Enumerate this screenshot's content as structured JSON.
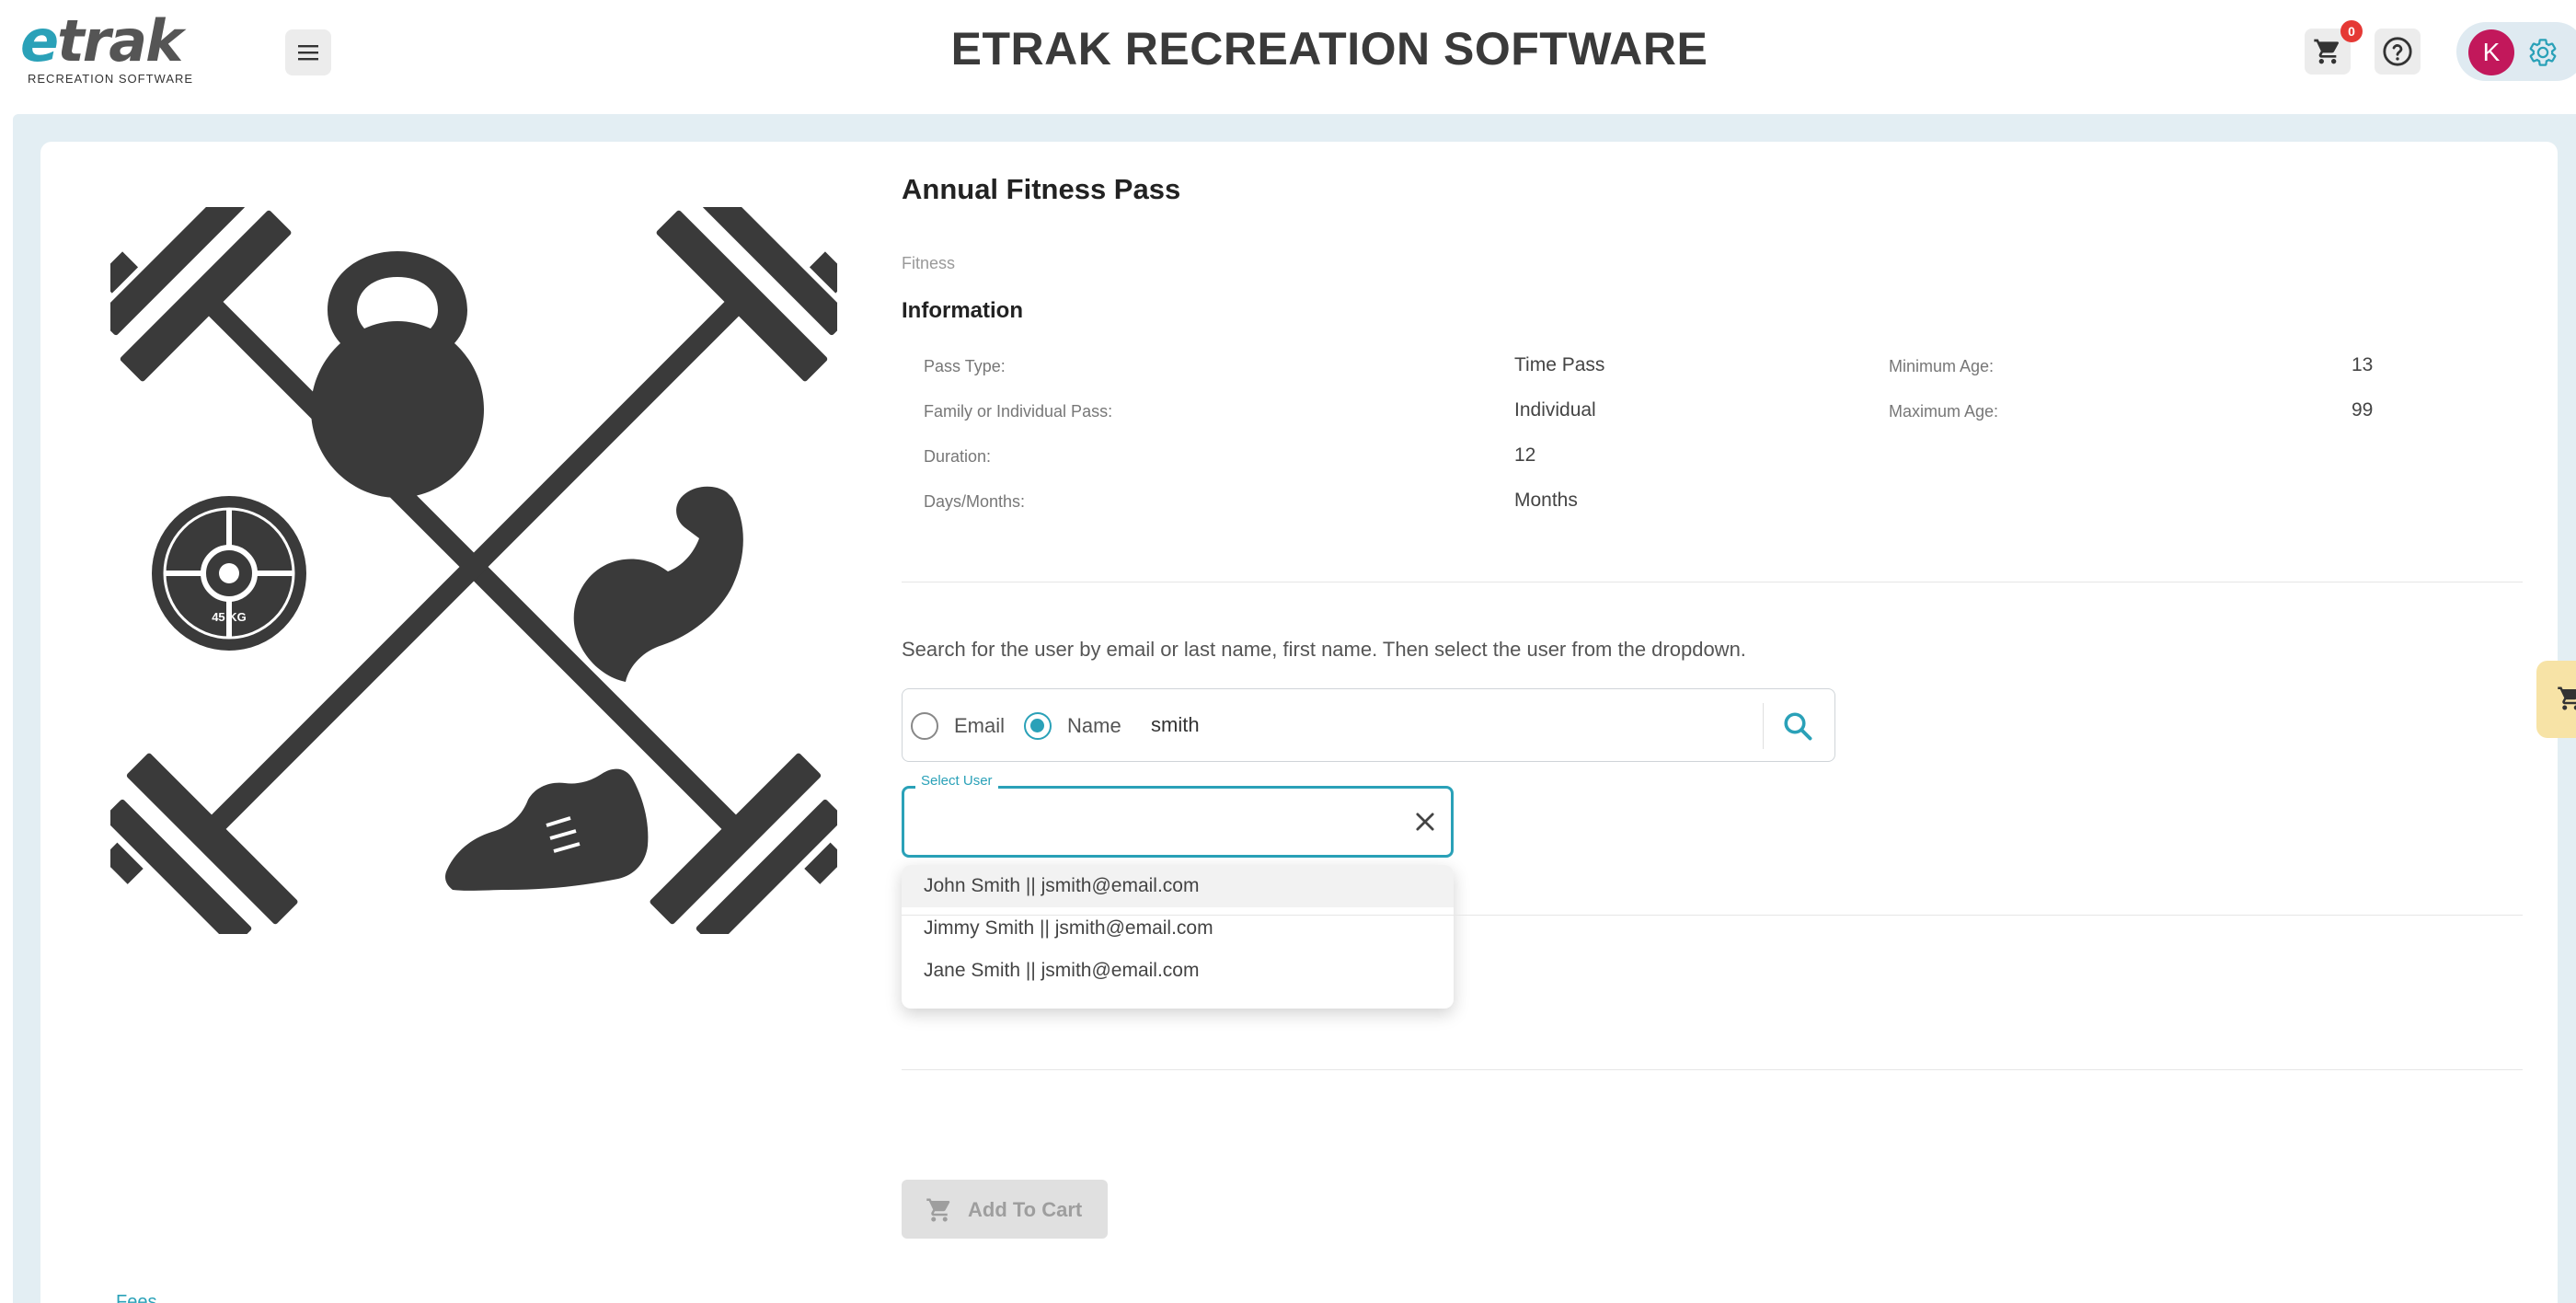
{
  "header": {
    "logo_word": "trak",
    "logo_e": "e",
    "logo_sub": "RECREATION SOFTWARE",
    "title": "ETRAK RECREATION SOFTWARE",
    "cart_count": "0",
    "avatar_initial": "K"
  },
  "pass": {
    "title": "Annual Fitness Pass",
    "category": "Fitness",
    "info_heading": "Information",
    "info": {
      "pass_type_label": "Pass Type:",
      "pass_type_value": "Time Pass",
      "family_label": "Family or Individual Pass:",
      "family_value": "Individual",
      "duration_label": "Duration:",
      "duration_value": "12",
      "days_months_label": "Days/Months:",
      "days_months_value": "Months",
      "min_age_label": "Minimum Age:",
      "min_age_value": "13",
      "max_age_label": "Maximum Age:",
      "max_age_value": "99"
    },
    "plate_text": "45 KG"
  },
  "search": {
    "instructions": "Search for the user by email or last name, first name. Then select the user from the dropdown.",
    "option_email": "Email",
    "option_name": "Name",
    "selected_option": "Name",
    "query": "smith"
  },
  "select_user": {
    "label": "Select User",
    "value": "",
    "options": [
      "John Smith || jsmith@email.com",
      "Jimmy Smith || jsmith@email.com",
      "Jane Smith || jsmith@email.com"
    ]
  },
  "actions": {
    "add_to_cart": "Add To Cart"
  },
  "footer": {
    "link": "Fees"
  },
  "colors": {
    "accent": "#2aa1b8",
    "badge": "#e53935",
    "avatar": "#c2185b",
    "icon_dark": "#3a3a3a"
  }
}
